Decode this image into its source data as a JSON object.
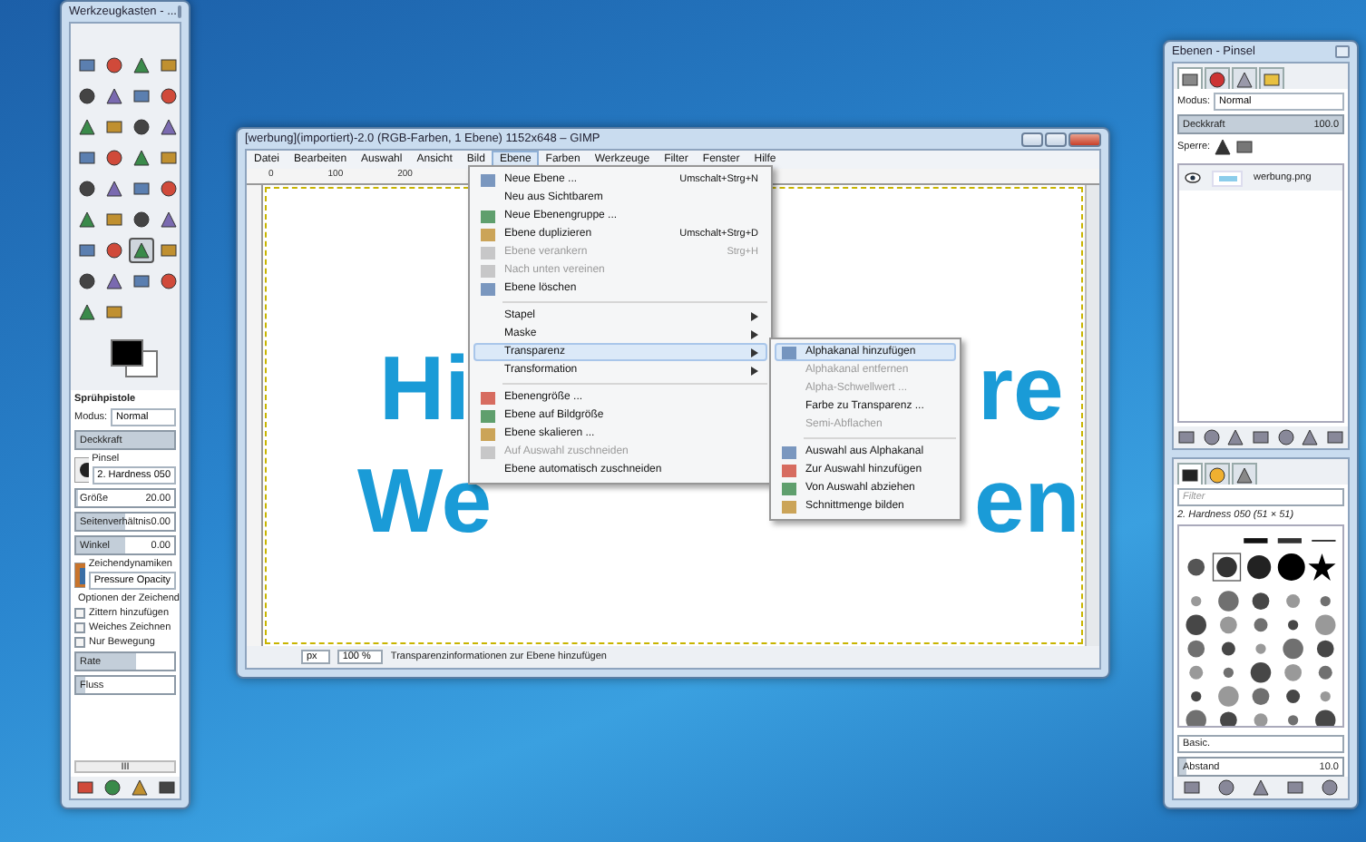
{
  "toolbox": {
    "title": "Werkzeugkasten - ...",
    "tools": [
      {
        "selected": false
      },
      {
        "selected": false
      },
      {
        "selected": false
      },
      {
        "selected": false
      },
      {
        "selected": false
      },
      {
        "selected": false
      },
      {
        "selected": false
      },
      {
        "selected": false
      },
      {
        "selected": false
      },
      {
        "selected": false
      },
      {
        "selected": false
      },
      {
        "selected": false
      },
      {
        "selected": false
      },
      {
        "selected": false
      },
      {
        "selected": false
      },
      {
        "selected": false
      },
      {
        "selected": false
      },
      {
        "selected": false
      },
      {
        "selected": false
      },
      {
        "selected": false
      },
      {
        "selected": false
      },
      {
        "selected": false
      },
      {
        "selected": false
      },
      {
        "selected": false
      },
      {
        "selected": false
      },
      {
        "selected": false
      },
      {
        "selected": true
      },
      {
        "selected": false
      },
      {
        "selected": false
      },
      {
        "selected": false
      },
      {
        "selected": false
      },
      {
        "selected": false
      },
      {
        "selected": false
      },
      {
        "selected": false
      }
    ]
  },
  "tool_options": {
    "title": "Sprühpistole",
    "mode_label": "Modus:",
    "mode": "Normal",
    "opacity": {
      "label": "Deckkraft",
      "level": 1
    },
    "brush_label": "Pinsel",
    "brush": "2. Hardness 050",
    "sliders": [
      {
        "label": "Größe",
        "value": "20.00",
        "level": 0.02
      },
      {
        "label": "Seitenverhältnis",
        "value": "0.00",
        "level": 0.5
      },
      {
        "label": "Winkel",
        "value": "0.00",
        "level": 0.5
      }
    ],
    "dynamics_label": "Zeichendynamiken",
    "dynamics": "Pressure Opacity",
    "expander": "Optionen der Zeichend",
    "checkboxes": [
      {
        "label": "Zittern hinzufügen",
        "checked": false
      },
      {
        "label": "Weiches Zeichnen",
        "checked": false
      },
      {
        "label": "Nur Bewegung",
        "checked": false
      }
    ],
    "rate_sliders": [
      {
        "label": "Rate",
        "level": 0.62
      },
      {
        "label": "Fluss",
        "level": 0.1
      }
    ],
    "scrollbar": "III"
  },
  "image_window": {
    "title": "[werbung](importiert)-2.0 (RGB-Farben, 1 Ebene) 1152x648 – GIMP",
    "menu": [
      {
        "label": "Datei",
        "selected": false
      },
      {
        "label": "Bearbeiten",
        "selected": false
      },
      {
        "label": "Auswahl",
        "selected": false
      },
      {
        "label": "Ansicht",
        "selected": false
      },
      {
        "label": "Bild",
        "selected": false
      },
      {
        "label": "Ebene",
        "selected": true
      },
      {
        "label": "Farben",
        "selected": false
      },
      {
        "label": "Werkzeuge",
        "selected": false
      },
      {
        "label": "Filter",
        "selected": false
      },
      {
        "label": "Fenster",
        "selected": false
      },
      {
        "label": "Hilfe",
        "selected": false
      }
    ],
    "ruler_labels": [
      "0",
      "100",
      "200"
    ],
    "canvas_text": [
      "Hi",
      "re",
      "We",
      "en"
    ],
    "unit": "px",
    "zoom": "100 %",
    "status": "Transparenzinformationen zur Ebene hinzufügen"
  },
  "layer_menu": [
    {
      "kind": "icon",
      "label": "Neue Ebene ...",
      "shortcut": "Umschalt+Strg+N",
      "disabled": false,
      "selected": false
    },
    {
      "kind": "plain",
      "label": "Neu aus Sichtbarem",
      "disabled": false,
      "selected": false
    },
    {
      "kind": "icon",
      "label": "Neue Ebenengruppe ...",
      "disabled": false,
      "selected": false
    },
    {
      "kind": "icon",
      "label": "Ebene duplizieren",
      "shortcut": "Umschalt+Strg+D",
      "disabled": false,
      "selected": false
    },
    {
      "kind": "icon",
      "label": "Ebene verankern",
      "shortcut": "Strg+H",
      "disabled": true,
      "selected": false
    },
    {
      "kind": "icon",
      "label": "Nach unten vereinen",
      "disabled": true,
      "selected": false
    },
    {
      "kind": "icon",
      "label": "Ebene löschen",
      "disabled": false,
      "selected": false
    },
    {
      "kind": "separator"
    },
    {
      "kind": "submenu",
      "label": "Stapel",
      "disabled": false,
      "selected": false
    },
    {
      "kind": "submenu",
      "label": "Maske",
      "disabled": false,
      "selected": false
    },
    {
      "kind": "submenu",
      "label": "Transparenz",
      "disabled": false,
      "selected": true
    },
    {
      "kind": "submenu",
      "label": "Transformation",
      "disabled": false,
      "selected": false
    },
    {
      "kind": "separator"
    },
    {
      "kind": "icon",
      "label": "Ebenengröße ...",
      "disabled": false,
      "selected": false
    },
    {
      "kind": "icon",
      "label": "Ebene auf Bildgröße",
      "disabled": false,
      "selected": false
    },
    {
      "kind": "icon",
      "label": "Ebene skalieren ...",
      "disabled": false,
      "selected": false
    },
    {
      "kind": "icon",
      "label": "Auf Auswahl zuschneiden",
      "disabled": true,
      "selected": false
    },
    {
      "kind": "plain",
      "label": "Ebene automatisch zuschneiden",
      "disabled": false,
      "selected": false
    }
  ],
  "transparency_menu": [
    {
      "kind": "icon",
      "label": "Alphakanal hinzufügen",
      "disabled": false,
      "selected": true
    },
    {
      "kind": "plain",
      "label": "Alphakanal entfernen",
      "disabled": true,
      "selected": false
    },
    {
      "kind": "plain",
      "label": "Alpha-Schwellwert ...",
      "disabled": true,
      "selected": false
    },
    {
      "kind": "plain",
      "label": "Farbe zu Transparenz ...",
      "disabled": false,
      "selected": false
    },
    {
      "kind": "plain",
      "label": "Semi-Abflachen",
      "disabled": true,
      "selected": false
    },
    {
      "kind": "separator"
    },
    {
      "kind": "icon",
      "label": "Auswahl aus Alphakanal",
      "disabled": false,
      "selected": false
    },
    {
      "kind": "icon",
      "label": "Zur Auswahl hinzufügen",
      "disabled": false,
      "selected": false
    },
    {
      "kind": "icon",
      "label": "Von Auswahl abziehen",
      "disabled": false,
      "selected": false
    },
    {
      "kind": "icon",
      "label": "Schnittmenge bilden",
      "disabled": false,
      "selected": false
    }
  ],
  "layers_panel": {
    "title": "Ebenen - Pinsel",
    "tabs": [
      {
        "selected": true
      },
      {
        "selected": false
      },
      {
        "selected": false
      },
      {
        "selected": false
      }
    ],
    "mode_label": "Modus:",
    "mode": "Normal",
    "opacity": {
      "label": "Deckkraft",
      "value": "100.0",
      "level": 1
    },
    "lock_label": "Sperre:",
    "layers": [
      {
        "name": "werbung.png",
        "selected": true,
        "visible": true
      }
    ]
  },
  "brushes_panel": {
    "tabs": [
      {
        "selected": true
      },
      {
        "selected": false
      },
      {
        "selected": false
      }
    ],
    "filter_placeholder": "Filter",
    "brush": "2. Hardness 050 (51 × 51)",
    "tag": "Basic.",
    "spacing": {
      "label": "Abstand",
      "value": "10.0",
      "level": 0.04
    }
  }
}
